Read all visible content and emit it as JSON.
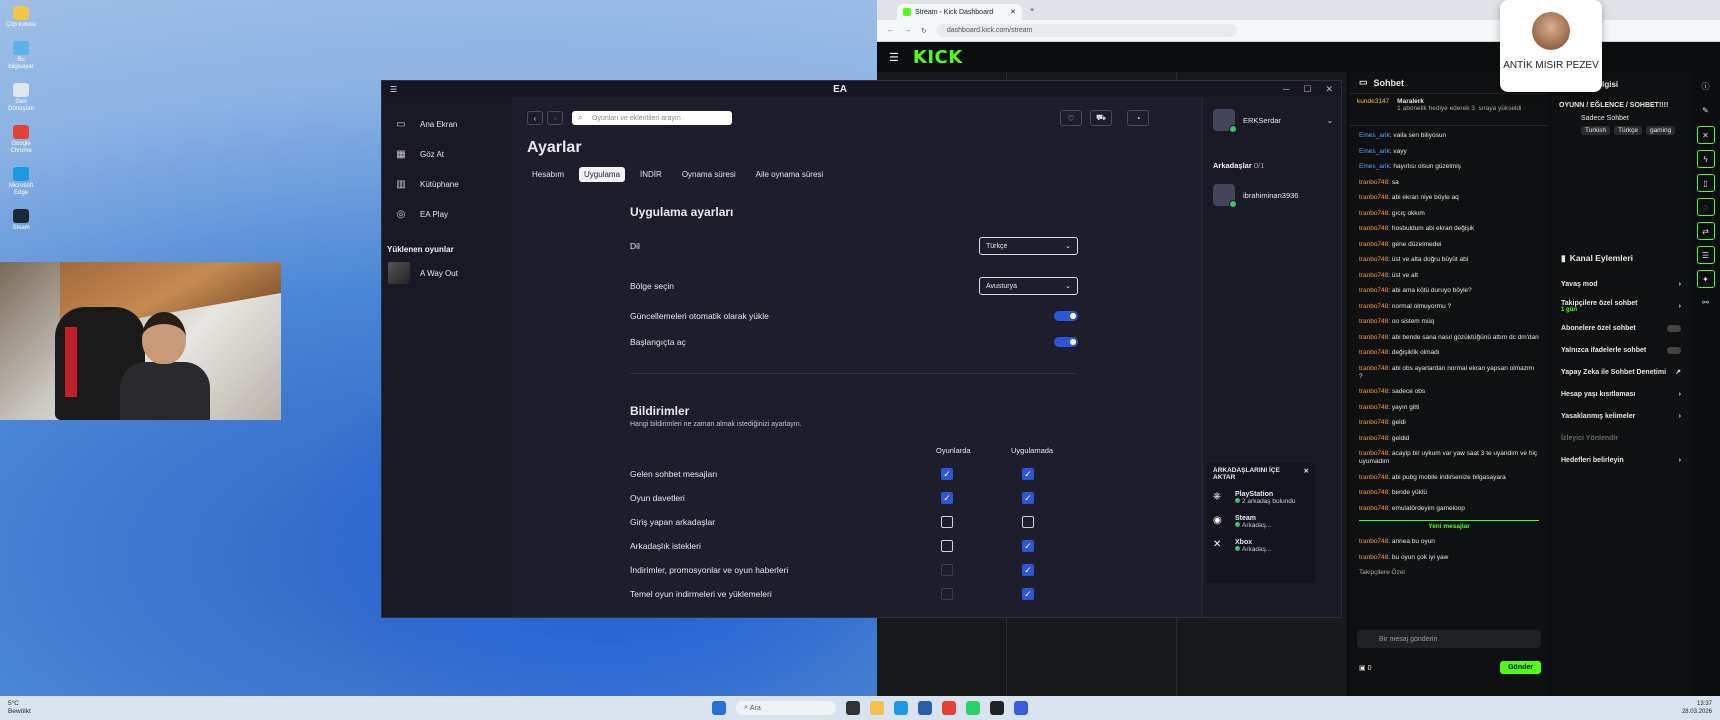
{
  "desktop": {
    "icons": [
      {
        "label": "Çöp kutusu",
        "color": "#f3c64a"
      },
      {
        "label": "Bu bilgisayar",
        "color": "#5bb3e8"
      },
      {
        "label": "Geri Dönüşüm",
        "color": "#dfe6ee"
      },
      {
        "label": "Google Chrome",
        "color": "#e44134"
      },
      {
        "label": "Microsoft Edge",
        "color": "#1a9ae0"
      },
      {
        "label": "Steam",
        "color": "#1b2838"
      }
    ]
  },
  "ea": {
    "title": "EA",
    "sidebar": {
      "items": [
        {
          "label": "Ana Ekran",
          "icon": "home-icon"
        },
        {
          "label": "Göz At",
          "icon": "grid-icon"
        },
        {
          "label": "Kütüphane",
          "icon": "library-icon"
        },
        {
          "label": "EA Play",
          "icon": "ea-play-icon"
        }
      ],
      "section": "Yüklenen oyunlar",
      "game": "A Way Out"
    },
    "search_placeholder": "Oyunları ve eklentileri arayın",
    "page_title": "Ayarlar",
    "tabs": [
      "Hesabım",
      "Uygulama",
      "İNDİR",
      "Oynama süresi",
      "Aile oynama süresi"
    ],
    "active_tab": "Uygulama",
    "app_settings": {
      "title": "Uygulama ayarları",
      "language_label": "Dil",
      "language_value": "Türkçe",
      "region_label": "Bölge seçin",
      "region_value": "Avusturya",
      "auto_update_label": "Güncellemeleri otomatik olarak yükle",
      "startup_label": "Başlangıçta aç"
    },
    "notifications": {
      "title": "Bildirimler",
      "subtitle": "Hangi bildirimleri ne zaman almak istediğinizi ayarlayın.",
      "col_ingame": "Oyunlarda",
      "col_app": "Uygulamada",
      "rows": [
        {
          "label": "Gelen sohbet mesajları",
          "ingame": true,
          "app": true
        },
        {
          "label": "Oyun davetleri",
          "ingame": true,
          "app": true
        },
        {
          "label": "Giriş yapan arkadaşlar",
          "ingame": false,
          "app": false
        },
        {
          "label": "Arkadaşlık istekleri",
          "ingame": false,
          "app": true
        },
        {
          "label": "İndirimler, promosyonlar ve oyun haberleri",
          "ingame": false,
          "app": true
        },
        {
          "label": "Temel oyun indirmeleri ve yüklemeleri",
          "ingame": false,
          "app": true
        }
      ]
    },
    "right": {
      "username": "ERKSerdar",
      "friends_label": "Arkadaşlar",
      "friends_count": "0/1",
      "friend": "ibrahiminan3936",
      "import_title": "ARKADAŞLARINI İÇE AKTAR",
      "imports": [
        {
          "name": "PlayStation",
          "status": "2 arkadaş bulundu"
        },
        {
          "name": "Steam",
          "status": "Arkadaş..."
        },
        {
          "name": "Xbox",
          "status": "Arkadaş..."
        }
      ]
    }
  },
  "chrome": {
    "tab_title": "Stream - Kick Dashboard",
    "url": "dashboard.kick.com/stream",
    "logo": "KICK"
  },
  "kick_chat": {
    "header": "Sohbet",
    "pinned_user": "kunde3147",
    "pinned_user2": "Maralerk",
    "pinned_text": "1 abonelik hediye ederek 3. sıraya yükseldi",
    "messages": [
      {
        "user": "Emes_arik",
        "text": "vaila sen biliyosun",
        "color": "u1"
      },
      {
        "user": "Emes_arik",
        "text": "vayy",
        "color": "u1"
      },
      {
        "user": "Emes_arik",
        "text": "hayırlısı olsun güzelmiş",
        "color": "u1"
      },
      {
        "user": "tranbo748",
        "text": "sa",
        "color": "u2"
      },
      {
        "user": "tranbo748",
        "text": "abi ekran niye böyle aq",
        "color": "u2"
      },
      {
        "user": "tranbo748",
        "text": "gıcıç okkım",
        "color": "u2"
      },
      {
        "user": "tranbo748",
        "text": "hosbuldum abi ekran değişik",
        "color": "u2"
      },
      {
        "user": "tranbo748",
        "text": "gene düzelmedei",
        "color": "u2"
      },
      {
        "user": "tranbo748",
        "text": "üst ve alta doğru büyüt abi",
        "color": "u2"
      },
      {
        "user": "tranbo748",
        "text": "üst ve alt",
        "color": "u2"
      },
      {
        "user": "tranbo748",
        "text": "abi ama kötü duruyo böyle?",
        "color": "u2"
      },
      {
        "user": "tranbo748",
        "text": "normal olmuyormu ?",
        "color": "u2"
      },
      {
        "user": "tranbo748",
        "text": "oo sistem müq",
        "color": "u2"
      },
      {
        "user": "tranbo748",
        "text": "abi bende sana nasıl gözüktüğünü attım dc dm'dan",
        "color": "u2"
      },
      {
        "user": "tranbo748",
        "text": "değişiklik olmadı",
        "color": "u2"
      },
      {
        "user": "tranbo748",
        "text": "abi obs ayarlardan normal ekran yapsan olmazmı ?",
        "color": "u2"
      },
      {
        "user": "tranbo748",
        "text": "sadece obs",
        "color": "u2"
      },
      {
        "user": "tranbo748",
        "text": "yayın gitti",
        "color": "u2"
      },
      {
        "user": "tranbo748",
        "text": "geldi",
        "color": "u2"
      },
      {
        "user": "tranbo748",
        "text": "geldid",
        "color": "u2"
      },
      {
        "user": "tranbo748",
        "text": "acayip bir uykum var yaw saat 3 te uyandım ve hiç uyumadım",
        "color": "u2"
      },
      {
        "user": "tranbo748",
        "text": "abi pubg mobile indirsenize bilgasayara",
        "color": "u2"
      },
      {
        "user": "tranbo748",
        "text": "bende yüklü",
        "color": "u2"
      },
      {
        "user": "tranbo748",
        "text": "emulatördeyim gameloop",
        "color": "u2"
      }
    ],
    "new_messages_label": "Yeni mesajlar",
    "new_messages": [
      {
        "user": "tranbo748",
        "text": "annea bu oyun",
        "color": "u2"
      },
      {
        "user": "tranbo748",
        "text": "bu oyun çok iyi yaw",
        "color": "u2"
      }
    ],
    "followers_only": "Takipçilere Özel",
    "input_placeholder": "Bir mesaj gönderin",
    "send_label": "Gönder",
    "count": "0"
  },
  "kick_right": {
    "title_suffix": "bilgisi",
    "stream_title": "OYUNN / EĞLENCE / SOHBET!!!!",
    "tag_label": "Sadece Sohbet",
    "tags": [
      "Turkish",
      "Türkçe",
      "gaming"
    ],
    "actions_title": "Kanal Eylemleri",
    "actions": [
      {
        "label": "Yavaş mod",
        "type": "arrow"
      },
      {
        "label": "Takipçilere özel sohbet",
        "sub": "1 gün",
        "type": "arrow"
      },
      {
        "label": "Abonelere özel sohbet",
        "type": "switch"
      },
      {
        "label": "Yalnızca ifadelerle sohbet",
        "type": "switch"
      },
      {
        "label": "Yapay Zeka ile Sohbet Denetimi",
        "type": "ext"
      },
      {
        "label": "Hesap yaşı kısıtlaması",
        "type": "arrow"
      },
      {
        "label": "Yasaklanmış kelimeler",
        "type": "arrow"
      },
      {
        "label": "İzleyici Yönlendir",
        "type": "none"
      },
      {
        "label": "Hedefleri belirleyin",
        "type": "arrow"
      }
    ]
  },
  "popup": {
    "name": "ANTİK MISIR PEZEV"
  },
  "taskbar": {
    "weather": "5°C",
    "weather_sub": "Bewölkt",
    "search": "Ara",
    "time": "13:37",
    "date": "28.03.2026"
  }
}
